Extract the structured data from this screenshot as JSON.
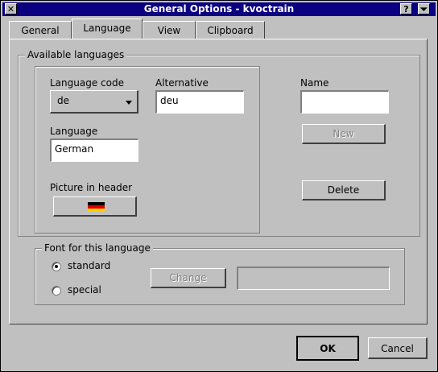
{
  "window": {
    "title": "General Options - kvoctrain"
  },
  "titlebar": {
    "close_symbol": "✕",
    "help_symbol": "?",
    "menu_symbol": "⏷"
  },
  "tabs": [
    {
      "label": "General",
      "active": false
    },
    {
      "label": "Language",
      "active": true
    },
    {
      "label": "View",
      "active": false
    },
    {
      "label": "Clipboard",
      "active": false
    }
  ],
  "available_languages": {
    "group_label": "Available languages",
    "language_code_label": "Language code",
    "language_code_value": "de",
    "alternative_label": "Alternative",
    "alternative_value": "deu",
    "language_label": "Language",
    "language_value": "German",
    "picture_label": "Picture in header",
    "picture_icon": "german-flag-icon",
    "flag_colors": [
      "#000000",
      "#dd0000",
      "#ffce00"
    ],
    "name_label": "Name",
    "name_value": "",
    "new_button": "New",
    "delete_button": "Delete"
  },
  "font": {
    "group_label": "Font for this language",
    "standard_label": "standard",
    "special_label": "special",
    "selected": "standard",
    "change_button": "Change",
    "font_preview": ""
  },
  "footer": {
    "ok_button": "OK",
    "cancel_button": "Cancel"
  }
}
